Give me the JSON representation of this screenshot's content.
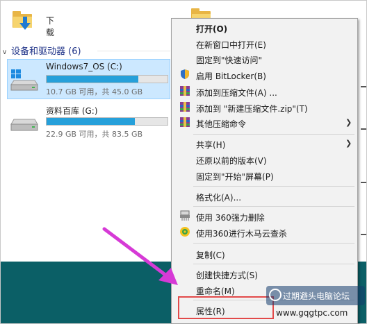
{
  "explorer": {
    "quick_item": {
      "label": "下载",
      "icon": "download-folder-icon"
    },
    "group": {
      "label": "设备和驱动器 (6)"
    },
    "drives": [
      {
        "name": "Windows7_OS (C:)",
        "used_fraction": 0.76,
        "detail": "10.7 GB 可用，共 45.0 GB",
        "icon": "windows-drive-icon",
        "selected": true
      },
      {
        "name": "资料百库 (G:)",
        "used_fraction": 0.73,
        "detail": "22.9 GB 可用，共 83.5 GB",
        "icon": "drive-icon",
        "selected": false
      }
    ]
  },
  "context_menu": {
    "items": [
      {
        "label": "打开(O)",
        "bold": true
      },
      {
        "label": "在新窗口中打开(E)"
      },
      {
        "label": "固定到\"快速访问\""
      },
      {
        "label": "启用 BitLocker(B)",
        "icon": "shield-icon"
      },
      {
        "label": "添加到压缩文件(A) ...",
        "icon": "archive-icon"
      },
      {
        "label": "添加到 \"新建压缩文件.zip\"(T)",
        "icon": "archive-icon"
      },
      {
        "label": "其他压缩命令",
        "icon": "archive-icon",
        "submenu": true
      },
      {
        "label": "共享(H)",
        "submenu": true
      },
      {
        "label": "还原以前的版本(V)"
      },
      {
        "label": "固定到\"开始\"屏幕(P)"
      },
      {
        "label": "格式化(A)..."
      },
      {
        "label": "使用 360强力删除",
        "icon": "shredder-icon"
      },
      {
        "label": "使用360进行木马云查杀",
        "icon": "360-scan-icon"
      },
      {
        "label": "复制(C)"
      },
      {
        "label": "创建快捷方式(S)"
      },
      {
        "label": "重命名(M)"
      },
      {
        "label": "属性(R)"
      }
    ]
  },
  "watermark": {
    "text": "过期避头电脑论坛",
    "url": "www.gqgtpc.com"
  },
  "colors": {
    "accent_arrow": "#d63ad6",
    "highlight_border": "#e24a4a",
    "drive_bar_fill": "#26a0da",
    "selection_bg": "#cce8ff"
  }
}
